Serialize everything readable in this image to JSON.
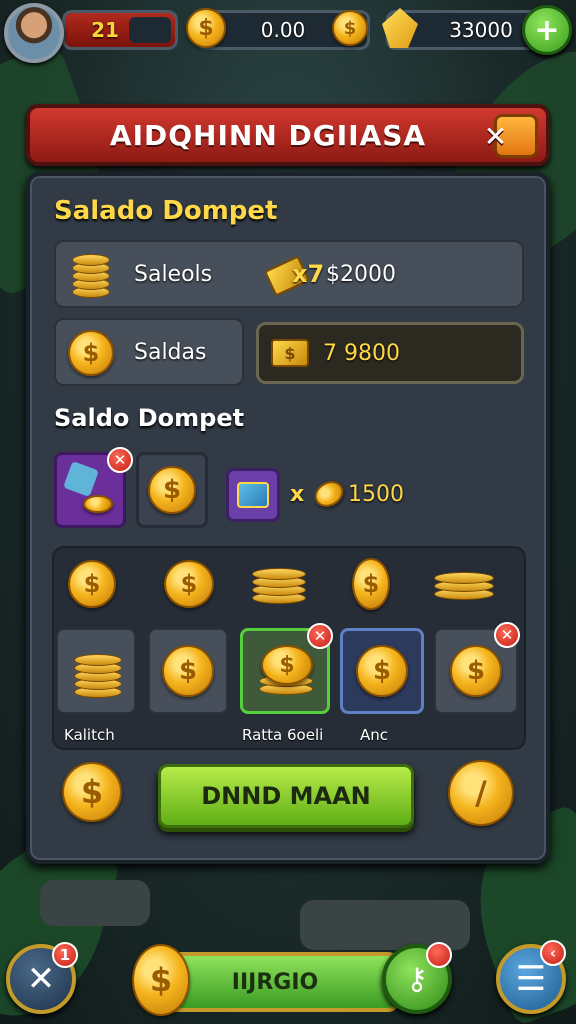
{
  "hud": {
    "level": "21",
    "gold_amount": "0.00",
    "gem_amount": "33000",
    "plus_symbol": "+"
  },
  "dialog": {
    "title": "AIDQHINN DGIIASA",
    "close_symbol": "✕",
    "section1_title": "Salado Dompet",
    "row1_label": "Saleols",
    "row1_multiplier": "x7",
    "row1_value": "$2000",
    "row2_label": "Saldas",
    "row2_value": "7 9800",
    "section2_title": "Saldo Dompet",
    "slot_x": "x",
    "slot_value": "1500",
    "grid_labels": [
      "Kalitch",
      "Ratta 6oeli",
      "Anc"
    ],
    "main_button": "DNND MAAN"
  },
  "bottom": {
    "bar_label": "IIJRGIO",
    "badge_count": "1"
  },
  "colors": {
    "accent_red": "#c52f25",
    "accent_green": "#7fd03a",
    "gold": "#f5b41d",
    "panel": "#313a45"
  },
  "icons": [
    "profile-avatar",
    "coin-icon",
    "gem-icon",
    "plus-icon",
    "close-icon",
    "coin-stack-icon",
    "gold-bar-icon",
    "dice-icon",
    "menu-icon",
    "settings-icon",
    "key-icon"
  ]
}
